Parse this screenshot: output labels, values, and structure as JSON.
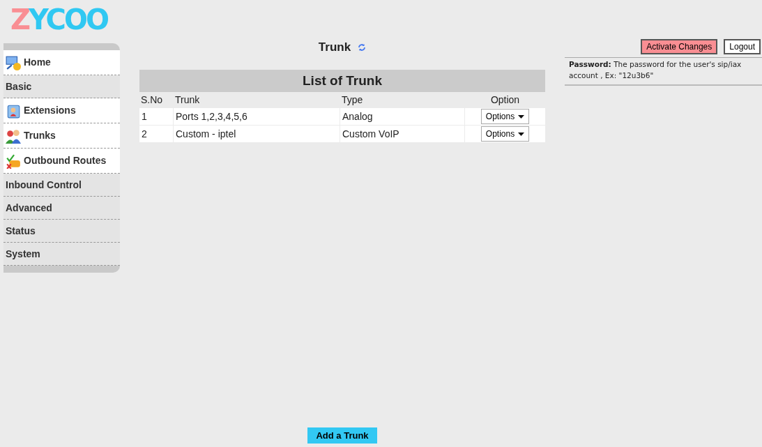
{
  "logo": {
    "text": "ZYCOO"
  },
  "sidebar": {
    "items": [
      {
        "label": "Home",
        "kind": "link"
      },
      {
        "label": "Basic",
        "kind": "section"
      },
      {
        "label": "Extensions",
        "kind": "link"
      },
      {
        "label": "Trunks",
        "kind": "link"
      },
      {
        "label": "Outbound Routes",
        "kind": "link"
      },
      {
        "label": "Inbound Control",
        "kind": "section"
      },
      {
        "label": "Advanced",
        "kind": "section"
      },
      {
        "label": "Status",
        "kind": "section"
      },
      {
        "label": "System",
        "kind": "section"
      }
    ]
  },
  "page_title": "Trunk",
  "table": {
    "title": "List of Trunk",
    "columns": [
      "S.No",
      "Trunk",
      "Type",
      "Option"
    ],
    "rows": [
      {
        "cells": [
          "1",
          "Ports 1,2,3,4,5,6",
          "Analog"
        ],
        "option": "Options"
      },
      {
        "cells": [
          "2",
          "Custom - iptel",
          "Custom VoIP"
        ],
        "option": "Options"
      }
    ]
  },
  "add_button": "Add a Trunk",
  "header_buttons": {
    "activate": "Activate Changes",
    "logout": "Logout"
  },
  "help": "**Password:** The password for the user's sip/iax account , Ex: \"12u3b6\""
}
